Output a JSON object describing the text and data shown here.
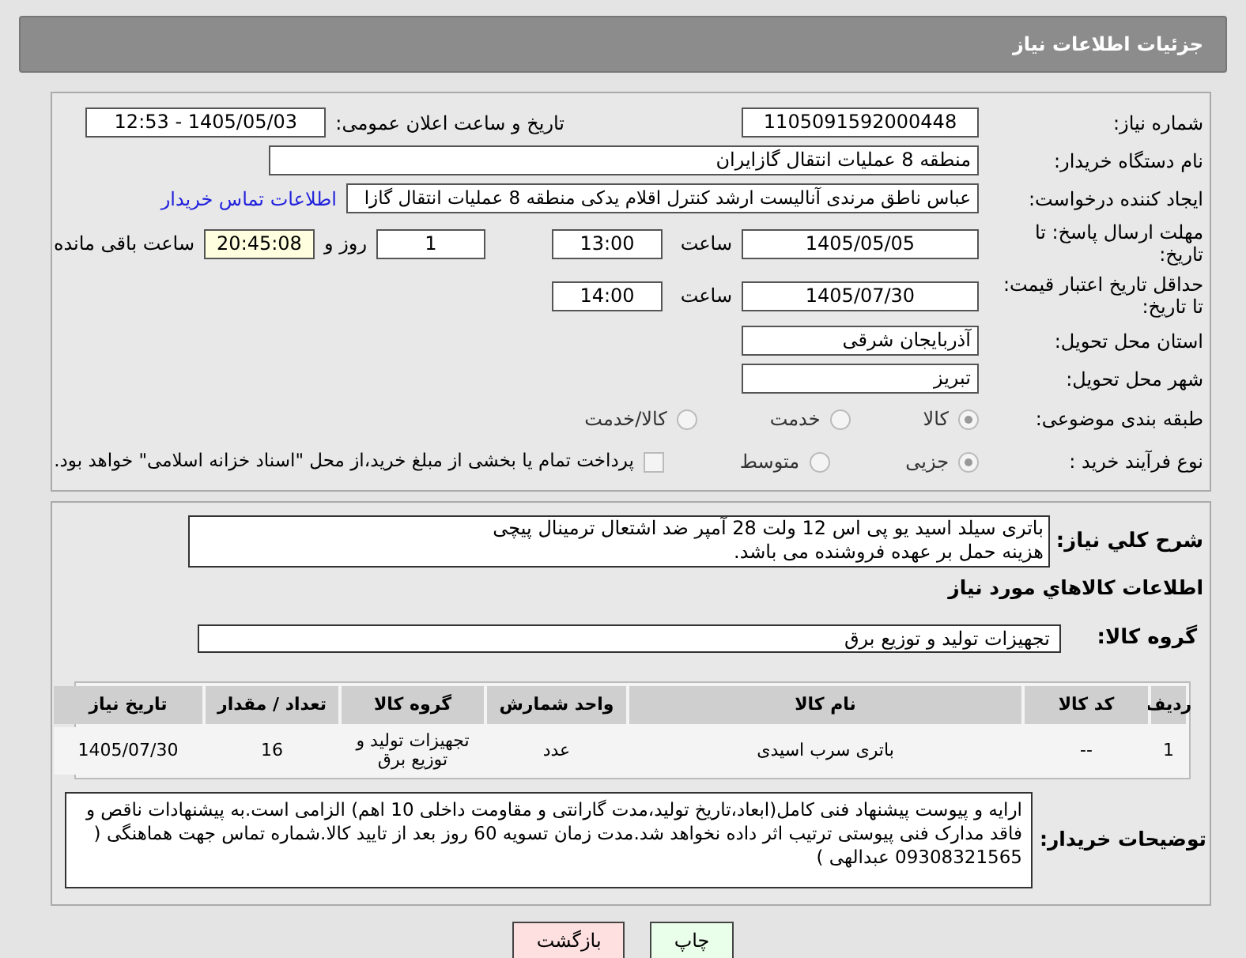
{
  "header": {
    "title": "جزئیات اطلاعات نیاز"
  },
  "need_number": {
    "label": "شماره نیاز:",
    "value": "1105091592000448"
  },
  "announce": {
    "label": "تاریخ و ساعت اعلان عمومی:",
    "value": "1405/05/03 - 12:53"
  },
  "buyer_org": {
    "label": "نام دستگاه خریدار:",
    "value": "منطقه 8 عملیات انتقال گازایران"
  },
  "requester": {
    "label": "ایجاد کننده درخواست:",
    "value": "عباس ناطق مرندی آنالیست ارشد کنترل اقلام یدکی منطقه 8 عملیات انتقال گازا",
    "link": "اطلاعات تماس خریدار"
  },
  "deadline": {
    "label": "مهلت ارسال پاسخ: تا تاریخ:",
    "date": "1405/05/05",
    "time_label": "ساعت",
    "time": "13:00",
    "days": "1",
    "days_label": "روز و",
    "remaining": "20:45:08",
    "remaining_label": "ساعت باقی مانده"
  },
  "validity": {
    "label": "حداقل تاریخ اعتبار قیمت: تا تاریخ:",
    "date": "1405/07/30",
    "time_label": "ساعت",
    "time": "14:00"
  },
  "province": {
    "label": "استان محل تحویل:",
    "value": "آذربایجان شرقی"
  },
  "city": {
    "label": "شهر محل تحویل:",
    "value": "تبریز"
  },
  "category": {
    "label": "طبقه بندی موضوعی:",
    "options": [
      {
        "label": "کالا",
        "selected": true
      },
      {
        "label": "خدمت",
        "selected": false
      },
      {
        "label": "کالا/خدمت",
        "selected": false
      }
    ]
  },
  "process": {
    "label": "نوع فرآیند خرید :",
    "options": [
      {
        "label": "جزیی",
        "selected": true
      },
      {
        "label": "متوسط",
        "selected": false
      }
    ],
    "payment": {
      "checked": false,
      "text": "پرداخت تمام یا بخشی از مبلغ خرید،از محل \"اسناد خزانه اسلامی\" خواهد بود."
    }
  },
  "description": {
    "label": "شرح کلي نياز:",
    "text": "باتری سیلد اسید یو پی اس 12 ولت 28 آمپر ضد اشتعال ترمینال پیچی\nهزینه حمل بر عهده فروشنده می باشد."
  },
  "goods_title": "اطلاعات کالاهاي مورد نياز",
  "goods_group": {
    "label": "گروه کالا:",
    "value": "تجهیزات تولید و توزیع برق"
  },
  "table": {
    "columns": [
      "ردیف",
      "کد کالا",
      "نام کالا",
      "واحد شمارش",
      "گروه کالا",
      "تعداد / مقدار",
      "تاریخ نیاز"
    ],
    "rows": [
      [
        "1",
        "--",
        "باتری سرب اسیدی",
        "عدد",
        "تجهیزات تولید و توزیع برق",
        "16",
        "1405/07/30"
      ]
    ]
  },
  "buyer_notes": {
    "label": "توضیحات خریدار:",
    "text": "ارایه و پیوست پیشنهاد فنی کامل(ابعاد،تاریخ تولید،مدت گارانتی و مقاومت داخلی 10 اهم) الزامی است.به پیشنهادات ناقص و فاقد مدارک فنی پیوستی ترتیب اثر داده نخواهد شد.مدت زمان تسویه 60 روز بعد از تایید کالا.شماره تماس جهت هماهنگی ( 09308321565 عبدالهی )"
  },
  "buttons": [
    {
      "label": "چاپ",
      "kind": "print"
    },
    {
      "label": "بازگشت",
      "kind": "back"
    }
  ]
}
